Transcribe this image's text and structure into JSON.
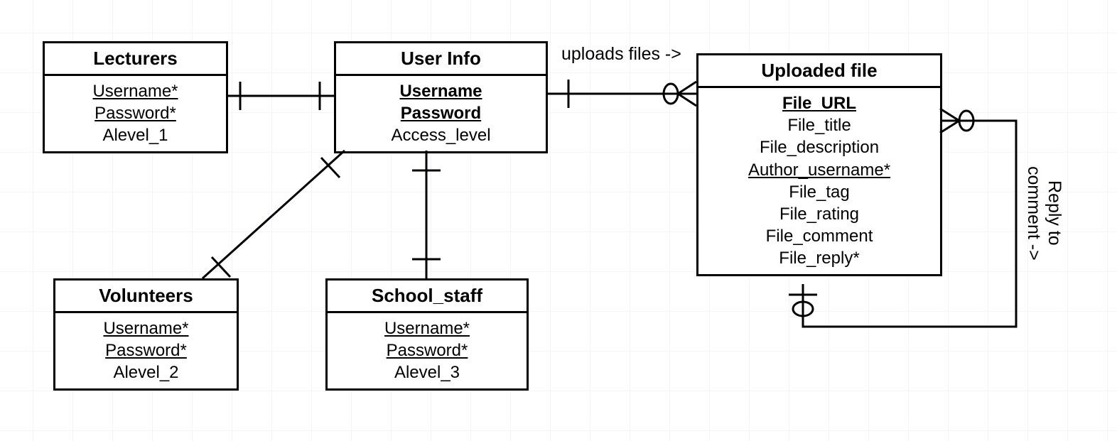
{
  "entities": {
    "lecturers": {
      "title": "Lecturers",
      "attrs": [
        "Username*",
        "Password*",
        "Alevel_1"
      ],
      "underline": [
        true,
        true,
        false
      ],
      "bold": [
        false,
        false,
        false
      ]
    },
    "userinfo": {
      "title": "User Info",
      "attrs": [
        "Username",
        "Password",
        "Access_level"
      ],
      "underline": [
        true,
        true,
        false
      ],
      "bold": [
        true,
        true,
        false
      ]
    },
    "uploaded": {
      "title": "Uploaded file",
      "attrs": [
        "File_URL",
        "File_title",
        "File_description",
        "Author_username*",
        "File_tag",
        "File_rating",
        "File_comment",
        "File_reply*"
      ],
      "underline": [
        true,
        false,
        false,
        true,
        false,
        false,
        false,
        false
      ],
      "bold": [
        true,
        false,
        false,
        false,
        false,
        false,
        false,
        false
      ]
    },
    "volunteers": {
      "title": "Volunteers",
      "attrs": [
        "Username*",
        "Password*",
        "Alevel_2"
      ],
      "underline": [
        true,
        true,
        false
      ],
      "bold": [
        false,
        false,
        false
      ]
    },
    "schoolstaff": {
      "title": "School_staff",
      "attrs": [
        "Username*",
        "Password*",
        "Alevel_3"
      ],
      "underline": [
        true,
        true,
        false
      ],
      "bold": [
        false,
        false,
        false
      ]
    }
  },
  "labels": {
    "uploads": "uploads files ->",
    "replyto": "Reply to\ncomment ->"
  }
}
